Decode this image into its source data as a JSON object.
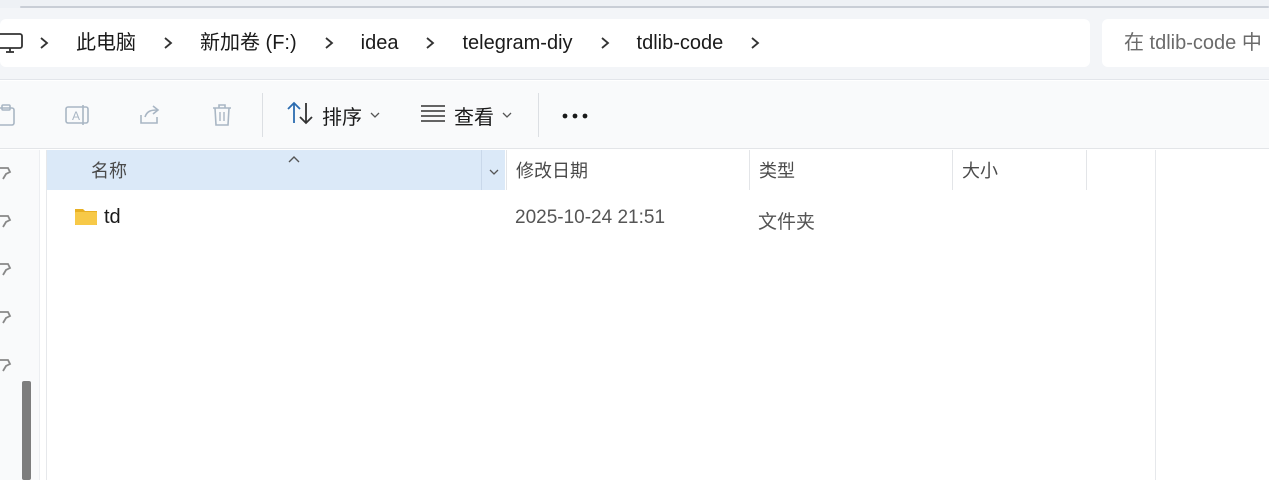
{
  "breadcrumb": {
    "items": [
      "此电脑",
      "新加卷 (F:)",
      "idea",
      "telegram-diy",
      "tdlib-code"
    ]
  },
  "search": {
    "placeholder": "在 tdlib-code 中"
  },
  "toolbar": {
    "sort_label": "排序",
    "view_label": "查看"
  },
  "columns": {
    "name": "名称",
    "date": "修改日期",
    "type": "类型",
    "size": "大小"
  },
  "files": [
    {
      "name": "td",
      "date": "2025-10-24 21:51",
      "type": "文件夹",
      "size": ""
    }
  ],
  "colors": {
    "header_selected": "#dbe9f8",
    "folder_yellow": "#f7c948",
    "accent_blue": "#2b6cb0"
  }
}
